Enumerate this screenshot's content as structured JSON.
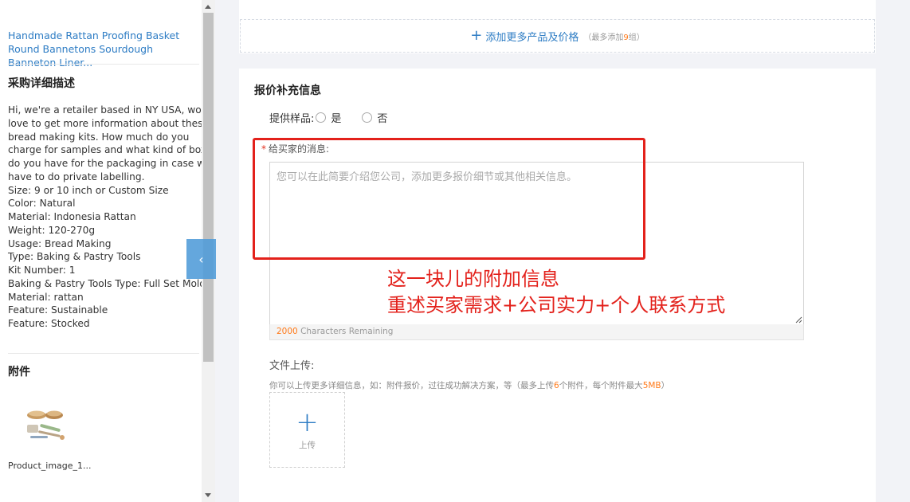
{
  "sidebar": {
    "product_link": "Handmade Rattan Proofing Basket Round Bannetons Sourdough Banneton Liner...",
    "desc_title": "采购详细描述",
    "desc_lines": [
      "Hi, we're a retailer based in NY USA, would",
      "love to get more information about these",
      "bread making kits. How much do you",
      "charge for samples and what kind of box",
      "do you have for the packaging in case we",
      "have to do private labelling.",
      "Size: 9 or 10 inch or Custom Size",
      "Color: Natural",
      "Material: Indonesia Rattan",
      "Weight: 120-270g",
      "Usage: Bread Making",
      "Type: Baking & Pastry Tools",
      "Kit Number: 1",
      "Baking & Pastry Tools Type: Full Set Mold",
      "Material: rattan",
      "Feature: Sustainable",
      "Feature: Stocked"
    ],
    "attachments_title": "附件",
    "attachment_name": "Product_image_1..."
  },
  "add_more": {
    "label": "添加更多产品及价格",
    "note_prefix": "（最多添加",
    "note_count": "9",
    "note_suffix": "组）"
  },
  "form": {
    "title": "报价补充信息",
    "sample_label": "提供样品:",
    "sample_yes": "是",
    "sample_no": "否",
    "message_star": "*",
    "message_label": "给买家的消息:",
    "message_placeholder": "您可以在此简要介绍您公司，添加更多报价细节或其他相关信息。",
    "counter_num": "2000",
    "counter_text": " Characters Remaining",
    "upload_label": "文件上传:",
    "upload_hint_1": "你可以上传更多详细信息，如：附件报价，过往成功解决方案，等（最多上传",
    "upload_hint_count": "6",
    "upload_hint_2": "个附件，每个附件最大",
    "upload_hint_size": "5MB",
    "upload_hint_3": "）",
    "upload_button": "上传"
  },
  "annotation": {
    "line1": "这一块儿的附加信息",
    "line2": "重述买家需求+公司实力+个人联系方式",
    "color": "#e3211b"
  },
  "colors": {
    "link": "#2d7cc4",
    "accent_orange": "#ff7a1a",
    "background": "#f2f3f7"
  }
}
